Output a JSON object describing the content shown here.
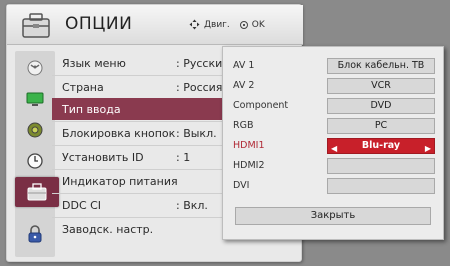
{
  "header": {
    "title": "ОПЦИИ",
    "nav_label": "Двиг.",
    "ok_label": "OK"
  },
  "sidebar": {
    "icons": [
      "satellite-dish-icon",
      "monitor-icon",
      "speaker-icon",
      "clock-icon",
      "options-icon",
      "lock-icon"
    ],
    "active_index": 4
  },
  "menu": {
    "items": [
      {
        "label": "Язык меню",
        "value": ": Русский"
      },
      {
        "label": "Страна",
        "value": ": Россия"
      },
      {
        "label": "Тип ввода",
        "value": ""
      },
      {
        "label": "Блокировка кнопок",
        "value": ": Выкл."
      },
      {
        "label": "Установить ID",
        "value": ": 1"
      },
      {
        "label": "Индикатор питания",
        "value": ""
      },
      {
        "label": "DDC CI",
        "value": ": Вкл."
      },
      {
        "label": "Заводск. настр.",
        "value": ""
      }
    ],
    "selected_index": 2
  },
  "input_popup": {
    "rows": [
      {
        "label": "AV 1",
        "value": "Блок кабельн. ТВ"
      },
      {
        "label": "AV 2",
        "value": "VCR"
      },
      {
        "label": "Component",
        "value": "DVD"
      },
      {
        "label": "RGB",
        "value": "PC"
      },
      {
        "label": "HDMI1",
        "value": "Blu-ray"
      },
      {
        "label": "HDMI2",
        "value": ""
      },
      {
        "label": "DVI",
        "value": ""
      }
    ],
    "active_index": 4,
    "close_label": "Закрыть"
  },
  "colors": {
    "accent": "#8a3a4f",
    "active_input": "#c8202a"
  }
}
